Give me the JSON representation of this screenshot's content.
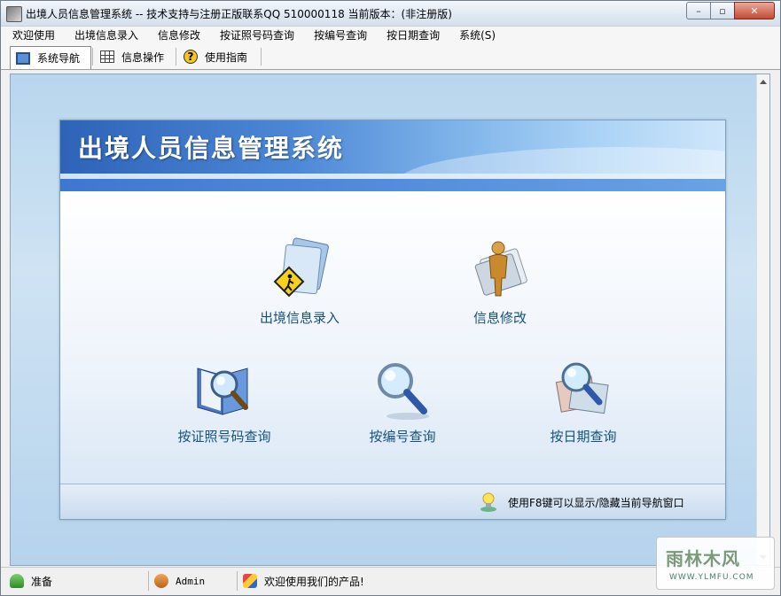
{
  "window": {
    "title": "出境人员信息管理系统 -- 技术支持与注册正版联系QQ 510000118     当前版本：(非注册版)",
    "minimize_label": "–",
    "maximize_label": "▫",
    "close_label": "✕"
  },
  "menu": {
    "items": [
      "欢迎使用",
      "出境信息录入",
      "信息修改",
      "按证照号码查询",
      "按编号查询",
      "按日期查询",
      "系统(S)"
    ]
  },
  "tabs": [
    {
      "label": "系统导航",
      "icon": "monitor-icon",
      "active": true
    },
    {
      "label": "信息操作",
      "icon": "grid-icon",
      "active": false
    },
    {
      "label": "使用指南",
      "icon": "help-icon",
      "active": false
    }
  ],
  "panel": {
    "app_name": "出境人员信息管理系统",
    "nav": [
      {
        "label": "出境信息录入",
        "icon": "folder-pedestrian-icon"
      },
      {
        "label": "信息修改",
        "icon": "person-document-icon"
      },
      {
        "label": "按证照号码查询",
        "icon": "book-magnifier-icon"
      },
      {
        "label": "按编号查询",
        "icon": "magnifier-icon"
      },
      {
        "label": "按日期查询",
        "icon": "photo-magnifier-icon"
      }
    ],
    "tip": "使用F8键可以显示/隐藏当前导航窗口"
  },
  "status": {
    "ready": "准备",
    "user": "Admin",
    "welcome": "欢迎使用我们的产品!"
  },
  "watermark": {
    "main": "雨林木风",
    "sub": "WWW.YLMFU.COM"
  },
  "colors": {
    "banner_start": "#2e63b8",
    "banner_end": "#cfe6fb",
    "nav_label": "#15517f",
    "client_bg": "#b8d6ee"
  }
}
